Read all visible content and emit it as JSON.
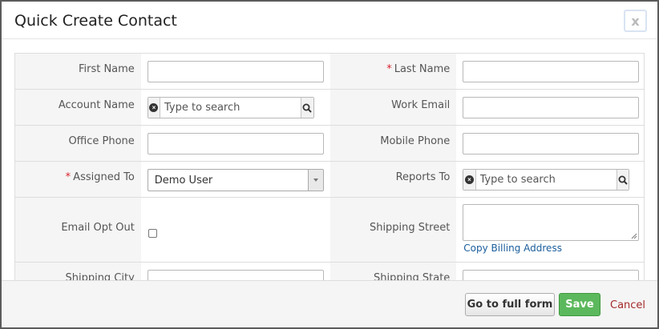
{
  "modal": {
    "title": "Quick Create Contact",
    "close_label": "x"
  },
  "fields": {
    "first_name": {
      "label": "First Name",
      "value": ""
    },
    "last_name": {
      "label": "Last Name",
      "required_mark": "*",
      "value": ""
    },
    "account_name": {
      "label": "Account Name",
      "placeholder": "Type to search"
    },
    "work_email": {
      "label": "Work Email",
      "value": ""
    },
    "office_phone": {
      "label": "Office Phone",
      "value": ""
    },
    "mobile_phone": {
      "label": "Mobile Phone",
      "value": ""
    },
    "assigned_to": {
      "label": "Assigned To",
      "required_mark": "*",
      "value": "Demo User"
    },
    "reports_to": {
      "label": "Reports To",
      "placeholder": "Type to search"
    },
    "email_opt_out": {
      "label": "Email Opt Out",
      "checked": false
    },
    "shipping_street": {
      "label": "Shipping Street",
      "value": "",
      "copy_link": "Copy Billing Address"
    },
    "shipping_city": {
      "label": "Shipping City",
      "value": ""
    },
    "shipping_state": {
      "label": "Shipping State",
      "value": ""
    }
  },
  "footer": {
    "full_form_label": "Go to full form",
    "save_label": "Save",
    "cancel_label": "Cancel"
  },
  "colors": {
    "save_green": "#5cb85c",
    "required_red": "#d9232d",
    "link_blue": "#1a5d9b",
    "cancel_red": "#a52a2a"
  }
}
